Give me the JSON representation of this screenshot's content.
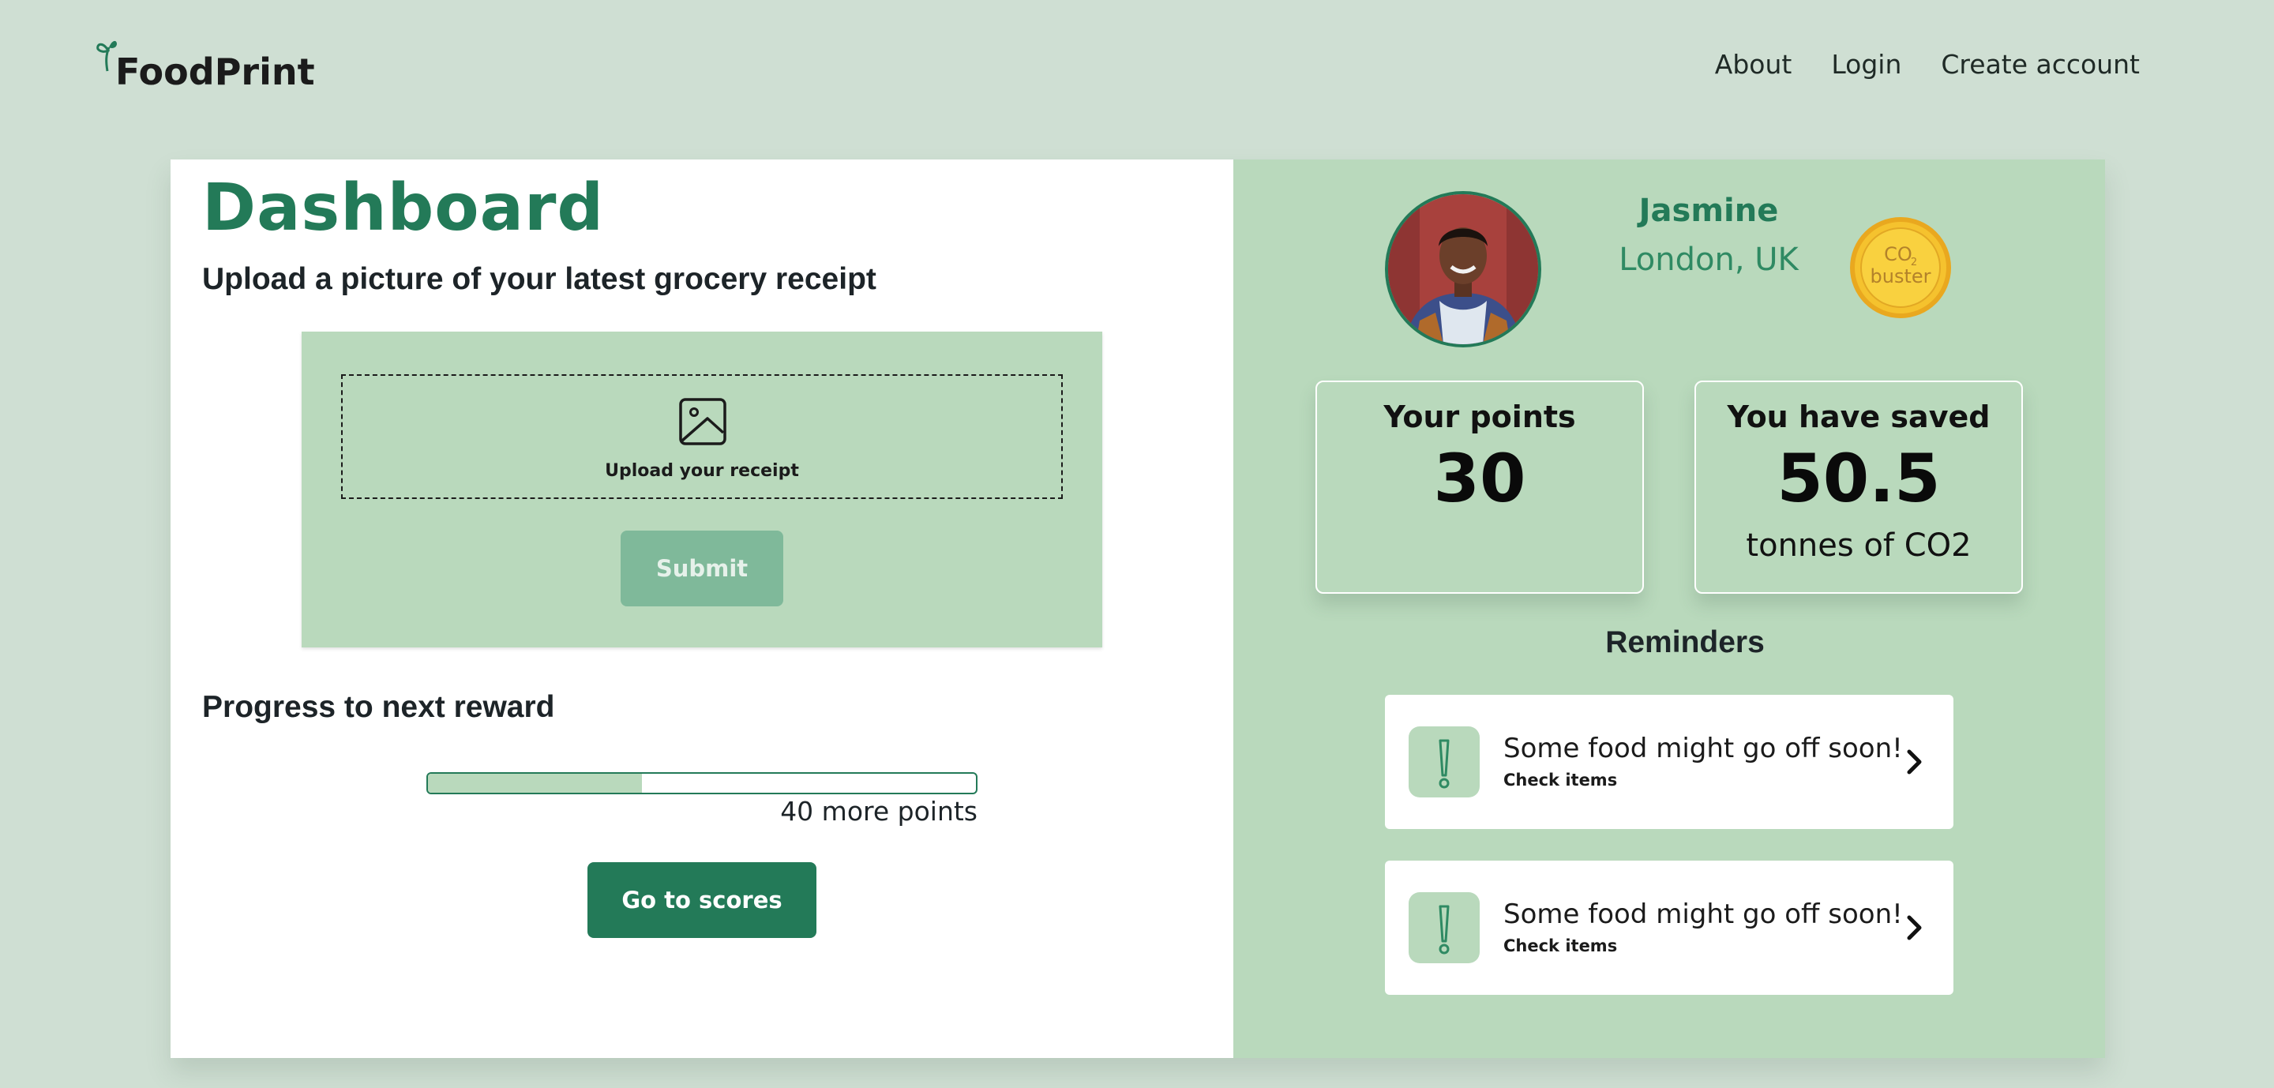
{
  "header": {
    "brand": "FoodPrint",
    "nav": [
      {
        "label": "About"
      },
      {
        "label": "Login"
      },
      {
        "label": "Create account"
      }
    ]
  },
  "dashboard": {
    "title": "Dashboard",
    "upload_heading": "Upload a picture of your latest grocery receipt",
    "dropzone_label": "Upload your receipt",
    "submit_label": "Submit",
    "progress_heading": "Progress to next reward",
    "progress_fraction": 0.39,
    "progress_label": "40 more points",
    "scores_button": "Go to scores"
  },
  "profile": {
    "name": "Jasmine",
    "location": "London, UK",
    "badge_line1": "CO",
    "badge_sub": "2",
    "badge_line2": "buster"
  },
  "stats": {
    "points_title": "Your points",
    "points_value": "30",
    "saved_title": "You have saved",
    "saved_value": "50.5",
    "saved_unit": "tonnes of CO2"
  },
  "reminders": {
    "heading": "Reminders",
    "items": [
      {
        "text": "Some food might go off soon!",
        "sub": "Check items"
      },
      {
        "text": "Some food might go off soon!",
        "sub": "Check items"
      }
    ]
  },
  "colors": {
    "background": "#cfdfd3",
    "accent": "#237a58",
    "panel": "#b9d9bc",
    "submit_disabled": "#7fb99a"
  }
}
